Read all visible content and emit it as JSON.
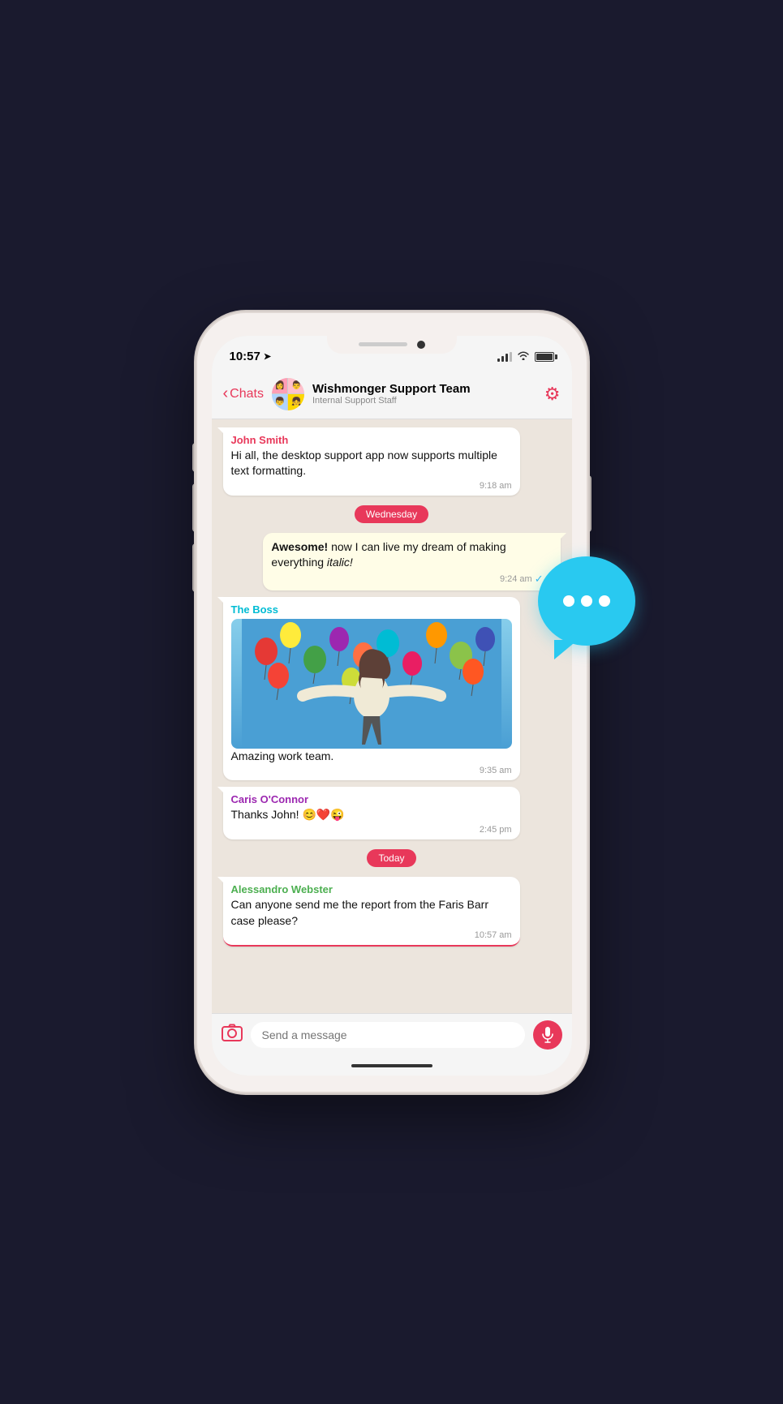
{
  "status_bar": {
    "time": "10:57",
    "location_icon": "➤"
  },
  "nav": {
    "back_label": "Chats",
    "group_name": "Wishmonger Support Team",
    "group_subtitle": "Internal Support Staff"
  },
  "date_labels": {
    "wednesday": "Wednesday",
    "today": "Today"
  },
  "messages": [
    {
      "id": "msg1",
      "type": "received",
      "sender": "John Smith",
      "sender_color": "john",
      "text": "Hi all, the desktop support app now supports multiple text formatting.",
      "time": "9:18 am"
    },
    {
      "id": "msg2",
      "type": "sent",
      "text_parts": [
        {
          "bold": true,
          "text": "Awesome!"
        },
        {
          "bold": false,
          "text": " now I can live my dream of making everything "
        },
        {
          "italic": true,
          "text": "italic!"
        }
      ],
      "time": "9:24 am"
    },
    {
      "id": "msg3",
      "type": "received",
      "sender": "The Boss",
      "sender_color": "boss",
      "has_image": true,
      "text": "Amazing work team.",
      "time": "9:35 am"
    },
    {
      "id": "msg4",
      "type": "received",
      "sender": "Caris O'Connor",
      "sender_color": "caris",
      "text": "Thanks John!  😊❤️😜",
      "time": "2:45 pm"
    },
    {
      "id": "msg5",
      "type": "received",
      "sender": "Alessandro Webster",
      "sender_color": "alex",
      "text": "Can anyone send me the report from the Faris Barr case please?",
      "time": "10:57 am",
      "is_last": true
    }
  ],
  "input": {
    "placeholder": "Send a message"
  },
  "bubble_deco": {
    "dots": [
      "•",
      "•",
      "•"
    ]
  }
}
